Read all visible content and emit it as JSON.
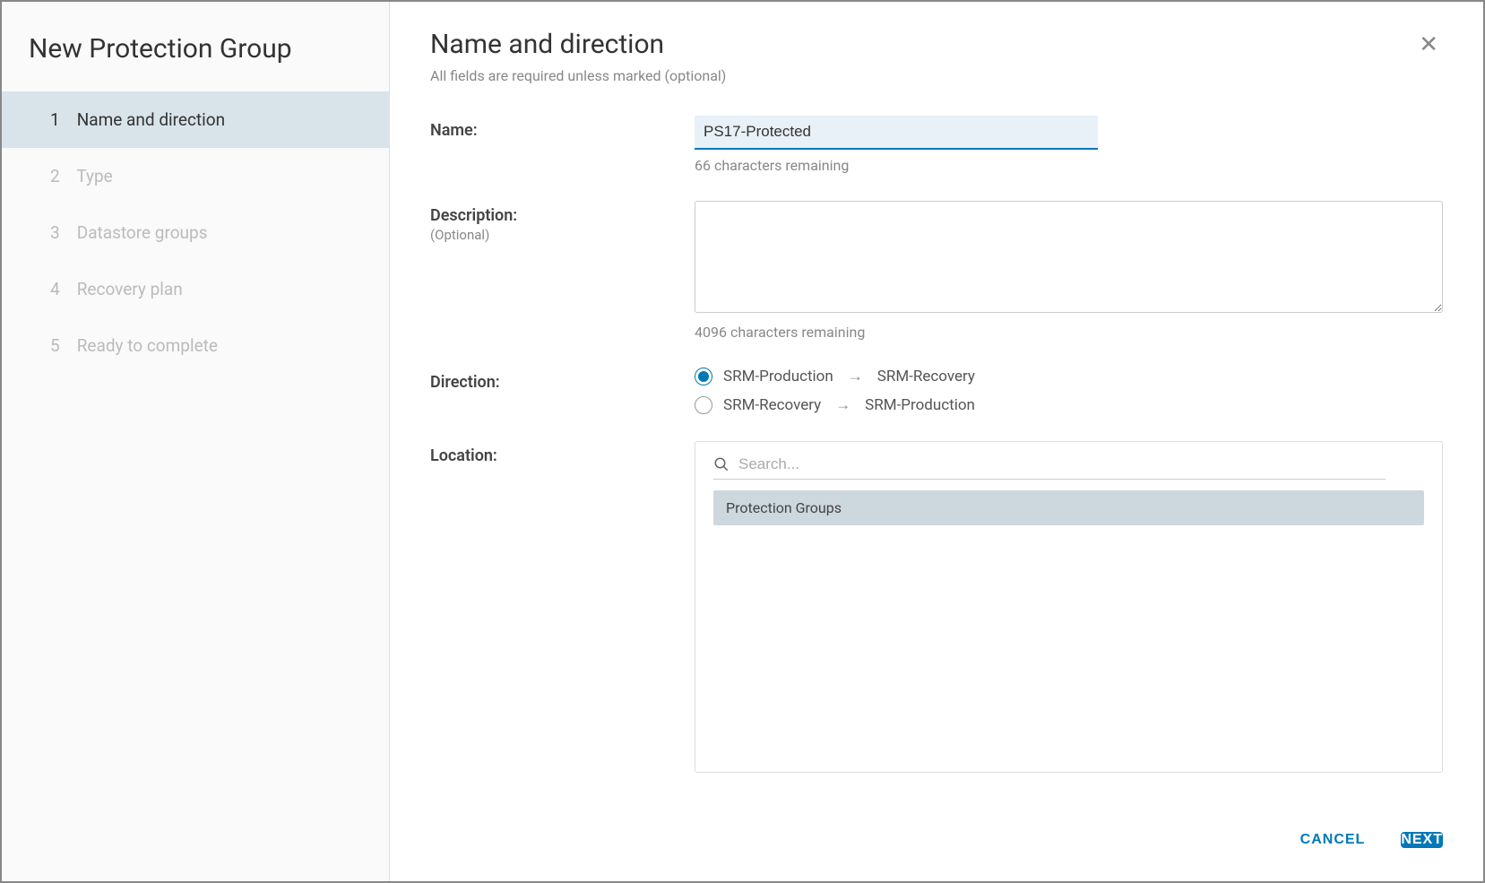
{
  "sidebar": {
    "title": "New Protection Group",
    "steps": [
      {
        "num": "1",
        "label": "Name and direction"
      },
      {
        "num": "2",
        "label": "Type"
      },
      {
        "num": "3",
        "label": "Datastore groups"
      },
      {
        "num": "4",
        "label": "Recovery plan"
      },
      {
        "num": "5",
        "label": "Ready to complete"
      }
    ]
  },
  "header": {
    "title": "Name and direction",
    "subtitle": "All fields are required unless marked (optional)"
  },
  "form": {
    "name_label": "Name:",
    "name_value": "PS17-Protected",
    "name_helper": "66 characters remaining",
    "desc_label": "Description:",
    "desc_optional": "(Optional)",
    "desc_value": "",
    "desc_helper": "4096 characters remaining",
    "direction_label": "Direction:",
    "direction_options": [
      {
        "from": "SRM-Production",
        "to": "SRM-Recovery",
        "selected": true
      },
      {
        "from": "SRM-Recovery",
        "to": "SRM-Production",
        "selected": false
      }
    ],
    "location_label": "Location:",
    "search_placeholder": "Search...",
    "location_item": "Protection Groups"
  },
  "footer": {
    "cancel": "CANCEL",
    "next": "NEXT"
  }
}
